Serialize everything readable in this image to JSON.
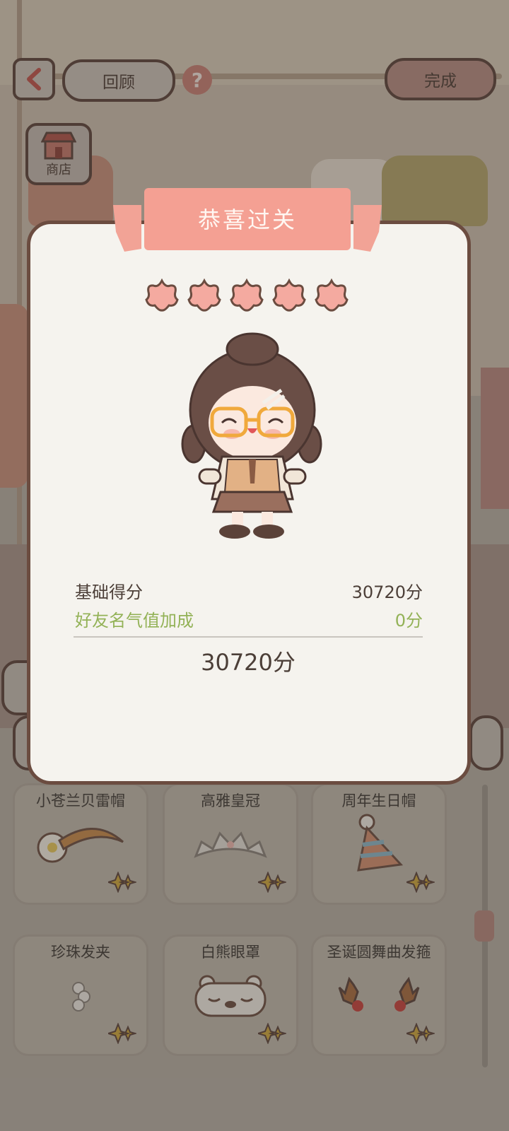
{
  "topbar": {
    "review_label": "回顾",
    "help_symbol": "?",
    "done_label": "完成",
    "shop_label": "商店"
  },
  "result": {
    "title": "恭喜过关",
    "stars_count": 5,
    "base_label": "基础得分",
    "base_value": "30720分",
    "bonus_label": "好友名气值加成",
    "bonus_value": "0分",
    "total": "30720分"
  },
  "items": [
    {
      "name": "小苍兰贝雷帽",
      "icon": "beret-hairband-icon"
    },
    {
      "name": "高雅皇冠",
      "icon": "tiara-icon"
    },
    {
      "name": "周年生日帽",
      "icon": "party-hat-icon"
    },
    {
      "name": "珍珠发夹",
      "icon": "pearl-clip-icon"
    },
    {
      "name": "白熊眼罩",
      "icon": "bear-eye-mask-icon"
    },
    {
      "name": "圣诞圆舞曲发箍",
      "icon": "reindeer-headband-icon"
    }
  ],
  "colors": {
    "accent": "#f4a093",
    "bonus_green": "#93b257",
    "border_brown": "#6b4c40",
    "panel_bg": "#f5f3ee"
  }
}
